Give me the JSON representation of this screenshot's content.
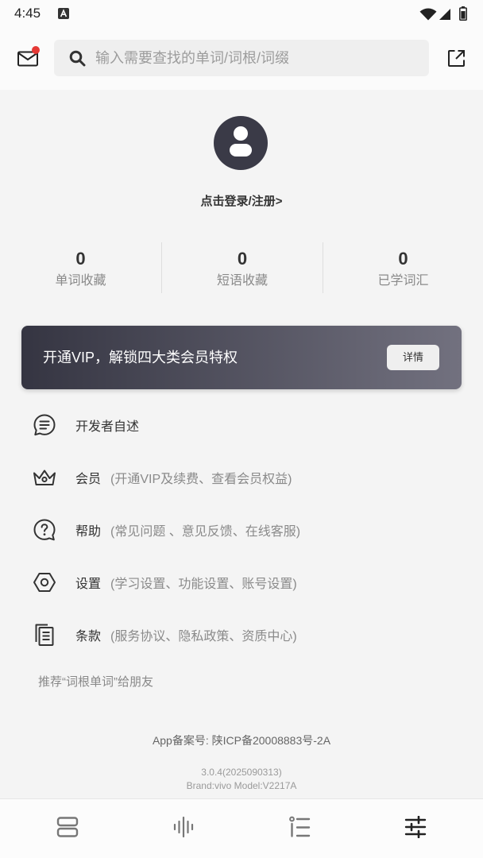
{
  "status_bar": {
    "time": "4:45",
    "notification_icon": "app-notification-icon",
    "icons": [
      "wifi-icon",
      "signal-icon",
      "battery-icon"
    ]
  },
  "header": {
    "mail_icon": "mail-icon",
    "has_unread": true,
    "search": {
      "icon": "search-icon",
      "placeholder": "输入需要查找的单词/词根/词缀"
    },
    "share_icon": "external-link-icon"
  },
  "profile": {
    "avatar_icon": "user-avatar-icon",
    "login_label": "点击登录/注册>"
  },
  "stats": [
    {
      "value": "0",
      "label": "单词收藏"
    },
    {
      "value": "0",
      "label": "短语收藏"
    },
    {
      "value": "0",
      "label": "已学词汇"
    }
  ],
  "vip_banner": {
    "text": "开通VIP，解锁四大类会员特权",
    "button_label": "详情"
  },
  "menu": [
    {
      "icon": "message-icon",
      "title": "开发者自述"
    },
    {
      "icon": "crown-icon",
      "title": "会员",
      "subtitle": "(开通VIP及续费、查看会员权益)"
    },
    {
      "icon": "help-icon",
      "title": "帮助",
      "subtitle": "(常见问题 、意见反馈、在线客服)"
    },
    {
      "icon": "hexagon-settings-icon",
      "title": "设置",
      "subtitle": "(学习设置、功能设置、账号设置)"
    },
    {
      "icon": "document-icon",
      "title": "条款",
      "subtitle": "(服务协议、隐私政策、资质中心)"
    }
  ],
  "recommend_label": "推荐“词根单词”给朋友",
  "footer": {
    "icp": "App备案号: 陕ICP备20008883号-2A",
    "version": "3.0.4(2025090313)",
    "device": "Brand:vivo Model:V2217A"
  },
  "bottom_nav": [
    {
      "icon": "stack-icon",
      "active": false
    },
    {
      "icon": "waveform-icon",
      "active": false
    },
    {
      "icon": "list-icon",
      "active": false
    },
    {
      "icon": "sliders-icon",
      "active": true
    }
  ],
  "theme": {
    "vip_gradient_start": "#353542",
    "vip_gradient_end": "#72717f",
    "avatar_bg": "#3a3a47",
    "unread_dot": "#e53935",
    "nav_active": "#222222",
    "nav_inactive": "#777777"
  }
}
